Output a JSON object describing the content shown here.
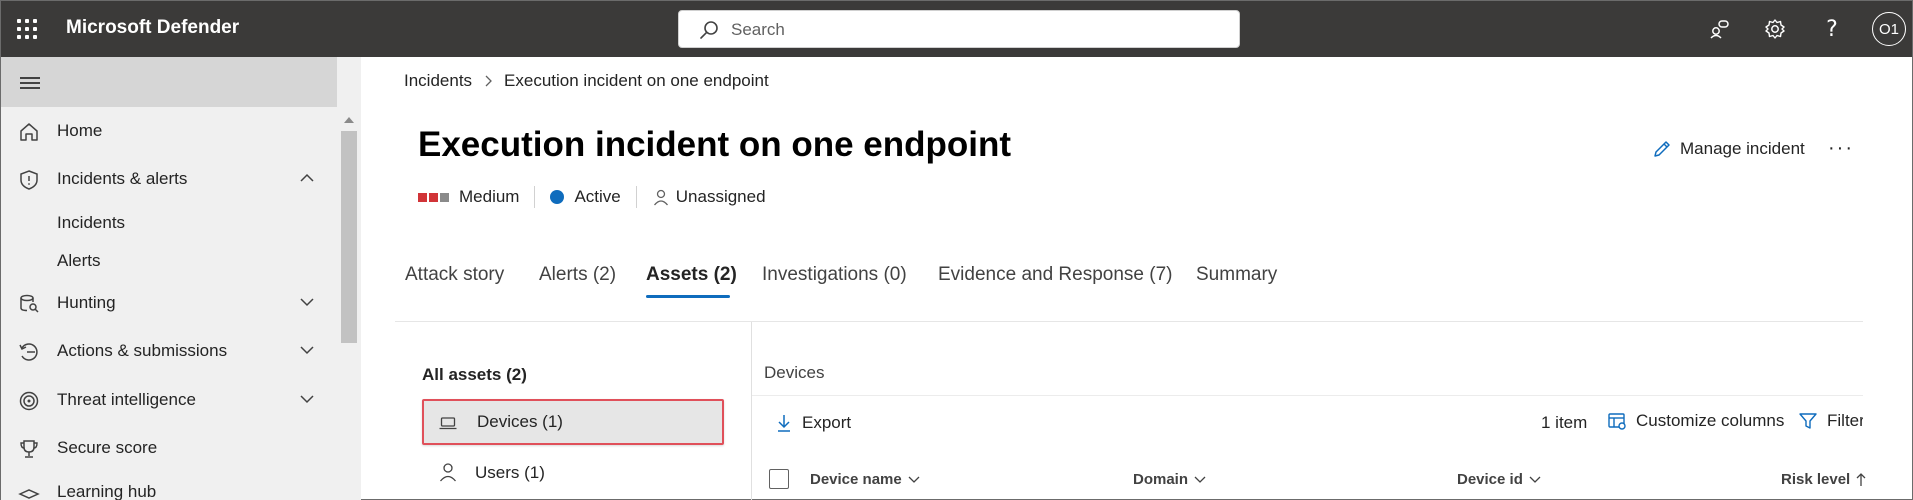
{
  "topbar": {
    "app_title": "Microsoft Defender",
    "search_placeholder": "Search",
    "avatar_initials": "O1",
    "icons": [
      "waffle-icon",
      "search-icon",
      "community-icon",
      "settings-icon",
      "help-icon"
    ]
  },
  "sidebar": {
    "items": [
      {
        "label": "Home",
        "icon": "home-icon"
      },
      {
        "label": "Incidents & alerts",
        "icon": "shield-icon",
        "expanded": true
      },
      {
        "label": "Incidents",
        "sub": true
      },
      {
        "label": "Alerts",
        "sub": true
      },
      {
        "label": "Hunting",
        "icon": "hunting-icon",
        "expanded": false
      },
      {
        "label": "Actions & submissions",
        "icon": "actions-icon",
        "expanded": false
      },
      {
        "label": "Threat intelligence",
        "icon": "threat-intel-icon",
        "expanded": false
      },
      {
        "label": "Secure score",
        "icon": "trophy-icon"
      },
      {
        "label": "Learning hub",
        "icon": "learning-icon"
      }
    ]
  },
  "breadcrumb": {
    "root": "Incidents",
    "current": "Execution incident on one endpoint"
  },
  "incident": {
    "title": "Execution incident on one endpoint",
    "severity": "Medium",
    "status": "Active",
    "assignee": "Unassigned",
    "manage_label": "Manage incident",
    "more_label": "···"
  },
  "tabs": [
    {
      "label": "Attack story",
      "active": false
    },
    {
      "label": "Alerts (2)",
      "active": false
    },
    {
      "label": "Assets (2)",
      "active": true
    },
    {
      "label": "Investigations (0)",
      "active": false
    },
    {
      "label": "Evidence and Response (7)",
      "active": false
    },
    {
      "label": "Summary",
      "active": false
    }
  ],
  "assets": {
    "heading": "All assets (2)",
    "items": [
      {
        "label": "Devices (1)",
        "icon": "laptop-icon",
        "selected": true
      },
      {
        "label": "Users (1)",
        "icon": "user-icon",
        "selected": false
      }
    ]
  },
  "devices_panel": {
    "heading": "Devices",
    "export_label": "Export",
    "item_count": "1 item",
    "customize_label": "Customize columns",
    "filter_label": "Filters",
    "columns": [
      {
        "label": "Device name",
        "sort": "chevron-down"
      },
      {
        "label": "Domain",
        "sort": "chevron-down"
      },
      {
        "label": "Device id",
        "sort": "chevron-down"
      },
      {
        "label": "Risk level",
        "sort": "arrow-up"
      }
    ]
  },
  "colors": {
    "topbar": "#3b3a39",
    "accent": "#0f6cbd",
    "severity_high": "#d13438",
    "severity_empty": "#8a8a8a",
    "selection_border": "#e0505a"
  }
}
